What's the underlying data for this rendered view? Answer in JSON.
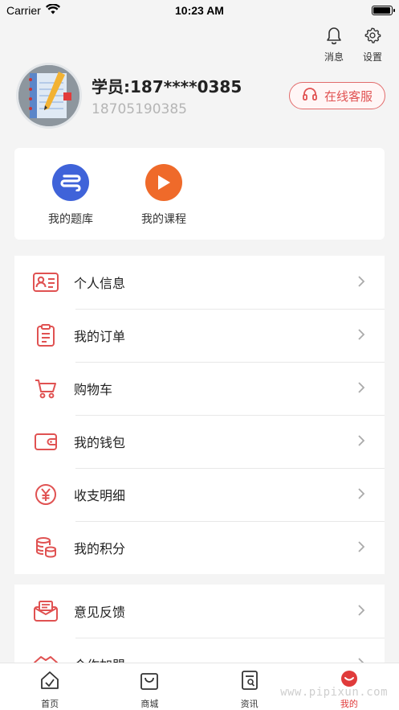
{
  "status_bar": {
    "carrier": "Carrier",
    "time": "10:23 AM",
    "battery_level": 0.95
  },
  "header": {
    "actions": [
      {
        "icon": "bell-icon",
        "label": "消息"
      },
      {
        "icon": "gear-icon",
        "label": "设置"
      }
    ]
  },
  "profile": {
    "name": "学员:187****0385",
    "phone": "18705190385",
    "service_button": "在线客服"
  },
  "shortcuts": [
    {
      "icon": "question-bank-icon",
      "label": "我的题库",
      "color": "#3f63d9"
    },
    {
      "icon": "play-icon",
      "label": "我的课程",
      "color": "#ef6a2a"
    }
  ],
  "menu_group_1": [
    {
      "icon": "id-card-icon",
      "label": "个人信息"
    },
    {
      "icon": "clipboard-icon",
      "label": "我的订单"
    },
    {
      "icon": "cart-icon",
      "label": "购物车"
    },
    {
      "icon": "wallet-icon",
      "label": "我的钱包"
    },
    {
      "icon": "yen-icon",
      "label": "收支明细"
    },
    {
      "icon": "coins-icon",
      "label": "我的积分"
    }
  ],
  "menu_group_2": [
    {
      "icon": "feedback-icon",
      "label": "意见反馈"
    },
    {
      "icon": "handshake-icon",
      "label": "合作加盟"
    }
  ],
  "tabbar": {
    "tabs": [
      {
        "icon": "home-icon",
        "label": "首页"
      },
      {
        "icon": "shopping-bag-icon",
        "label": "商城"
      },
      {
        "icon": "news-icon",
        "label": "资讯"
      },
      {
        "icon": "mine-icon",
        "label": "我的"
      }
    ],
    "active_index": 3
  },
  "watermark": "www.pipixun.com",
  "colors": {
    "accent": "#e03b3b",
    "icon_red": "#e05252",
    "background": "#f4f4f4"
  }
}
